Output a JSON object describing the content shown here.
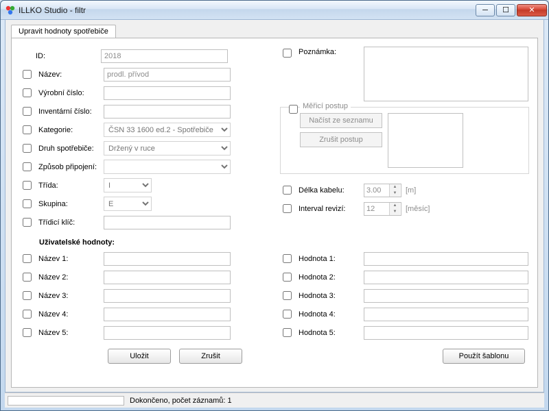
{
  "window": {
    "title": "ILLKO Studio - filtr"
  },
  "tabs": {
    "active": "Upravit hodnoty spotřebiče"
  },
  "left": {
    "id_label": "ID:",
    "id_value": "2018",
    "nazev_label": "Název:",
    "nazev_value": "prodl. přívod",
    "vyrobni_label": "Výrobní číslo:",
    "vyrobni_value": "",
    "inventarni_label": "Inventární číslo:",
    "inventarni_value": "",
    "kategorie_label": "Kategorie:",
    "kategorie_value": "ČSN 33 1600 ed.2 - Spotřebiče",
    "druh_label": "Druh spotřebiče:",
    "druh_value": "Držený v ruce",
    "zpusob_label": "Způsob připojení:",
    "zpusob_value": "",
    "trida_label": "Třída:",
    "trida_value": "I",
    "skupina_label": "Skupina:",
    "skupina_value": "E",
    "tridici_label": "Třídicí klíč:",
    "tridici_value": ""
  },
  "right": {
    "poznamka_label": "Poznámka:",
    "poznamka_value": "",
    "merici_group_title": "Měřicí postup",
    "btn_nacist": "Načíst ze seznamu",
    "btn_zrusit_postup": "Zrušit postup",
    "delka_label": "Délka kabelu:",
    "delka_value": "3.00",
    "delka_unit": "[m]",
    "interval_label": "Interval revizí:",
    "interval_value": "12",
    "interval_unit": "[měsíc]"
  },
  "user_values": {
    "section_title": "Uživatelské hodnoty:",
    "nazev1": "Název 1:",
    "nazev2": "Název 2:",
    "nazev3": "Název 3:",
    "nazev4": "Název 4:",
    "nazev5": "Název 5:",
    "hodnota1": "Hodnota 1:",
    "hodnota2": "Hodnota 2:",
    "hodnota3": "Hodnota 3:",
    "hodnota4": "Hodnota 4:",
    "hodnota5": "Hodnota 5:"
  },
  "buttons": {
    "save": "Uložit",
    "cancel": "Zrušit",
    "template": "Použít šablonu"
  },
  "status": {
    "text": "Dokončeno, počet záznamů: 1"
  }
}
